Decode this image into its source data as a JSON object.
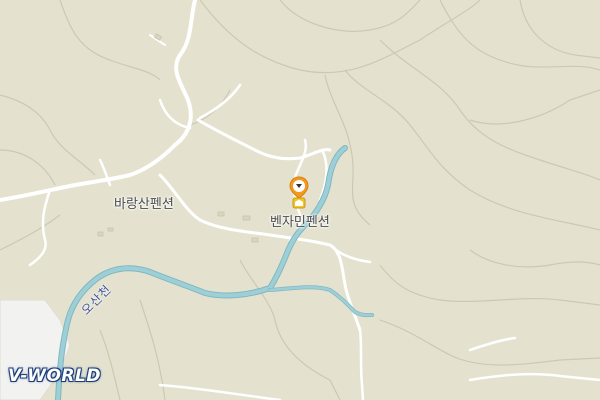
{
  "map": {
    "places": [
      {
        "id": "barangsan",
        "label": "바랑산펜션"
      },
      {
        "id": "benjamin",
        "label": "벤자민펜션"
      }
    ],
    "river": {
      "label": "오산천"
    },
    "logo": {
      "text": "V-WORLD"
    },
    "colors": {
      "land": "#e4e2cf",
      "contour": "#cdc8b0",
      "road": "#ffffff",
      "river": "#9fcfd6",
      "river_edge": "#7fb8c2",
      "urban": "#f2f2f0",
      "pin": "#f39a1e"
    },
    "marker": {
      "icon": "location-pin-icon",
      "badge": "pension-icon"
    }
  }
}
